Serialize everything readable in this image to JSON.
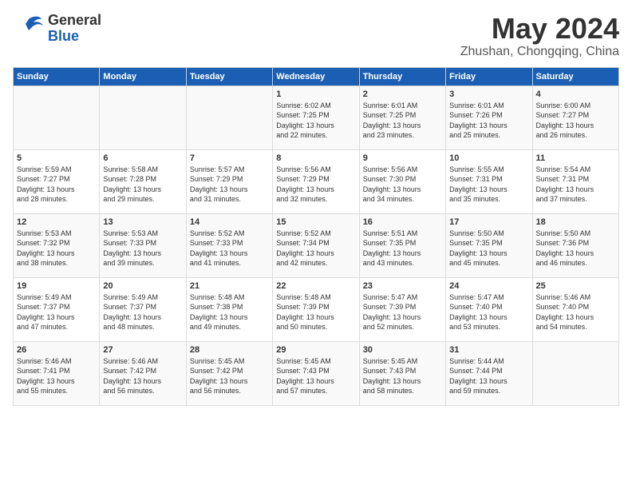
{
  "header": {
    "logo_general": "General",
    "logo_blue": "Blue",
    "month": "May 2024",
    "location": "Zhushan, Chongqing, China"
  },
  "weekdays": [
    "Sunday",
    "Monday",
    "Tuesday",
    "Wednesday",
    "Thursday",
    "Friday",
    "Saturday"
  ],
  "weeks": [
    [
      {
        "day": "",
        "content": ""
      },
      {
        "day": "",
        "content": ""
      },
      {
        "day": "",
        "content": ""
      },
      {
        "day": "1",
        "content": "Sunrise: 6:02 AM\nSunset: 7:25 PM\nDaylight: 13 hours\nand 22 minutes."
      },
      {
        "day": "2",
        "content": "Sunrise: 6:01 AM\nSunset: 7:25 PM\nDaylight: 13 hours\nand 23 minutes."
      },
      {
        "day": "3",
        "content": "Sunrise: 6:01 AM\nSunset: 7:26 PM\nDaylight: 13 hours\nand 25 minutes."
      },
      {
        "day": "4",
        "content": "Sunrise: 6:00 AM\nSunset: 7:27 PM\nDaylight: 13 hours\nand 26 minutes."
      }
    ],
    [
      {
        "day": "5",
        "content": "Sunrise: 5:59 AM\nSunset: 7:27 PM\nDaylight: 13 hours\nand 28 minutes."
      },
      {
        "day": "6",
        "content": "Sunrise: 5:58 AM\nSunset: 7:28 PM\nDaylight: 13 hours\nand 29 minutes."
      },
      {
        "day": "7",
        "content": "Sunrise: 5:57 AM\nSunset: 7:29 PM\nDaylight: 13 hours\nand 31 minutes."
      },
      {
        "day": "8",
        "content": "Sunrise: 5:56 AM\nSunset: 7:29 PM\nDaylight: 13 hours\nand 32 minutes."
      },
      {
        "day": "9",
        "content": "Sunrise: 5:56 AM\nSunset: 7:30 PM\nDaylight: 13 hours\nand 34 minutes."
      },
      {
        "day": "10",
        "content": "Sunrise: 5:55 AM\nSunset: 7:31 PM\nDaylight: 13 hours\nand 35 minutes."
      },
      {
        "day": "11",
        "content": "Sunrise: 5:54 AM\nSunset: 7:31 PM\nDaylight: 13 hours\nand 37 minutes."
      }
    ],
    [
      {
        "day": "12",
        "content": "Sunrise: 5:53 AM\nSunset: 7:32 PM\nDaylight: 13 hours\nand 38 minutes."
      },
      {
        "day": "13",
        "content": "Sunrise: 5:53 AM\nSunset: 7:33 PM\nDaylight: 13 hours\nand 39 minutes."
      },
      {
        "day": "14",
        "content": "Sunrise: 5:52 AM\nSunset: 7:33 PM\nDaylight: 13 hours\nand 41 minutes."
      },
      {
        "day": "15",
        "content": "Sunrise: 5:52 AM\nSunset: 7:34 PM\nDaylight: 13 hours\nand 42 minutes."
      },
      {
        "day": "16",
        "content": "Sunrise: 5:51 AM\nSunset: 7:35 PM\nDaylight: 13 hours\nand 43 minutes."
      },
      {
        "day": "17",
        "content": "Sunrise: 5:50 AM\nSunset: 7:35 PM\nDaylight: 13 hours\nand 45 minutes."
      },
      {
        "day": "18",
        "content": "Sunrise: 5:50 AM\nSunset: 7:36 PM\nDaylight: 13 hours\nand 46 minutes."
      }
    ],
    [
      {
        "day": "19",
        "content": "Sunrise: 5:49 AM\nSunset: 7:37 PM\nDaylight: 13 hours\nand 47 minutes."
      },
      {
        "day": "20",
        "content": "Sunrise: 5:49 AM\nSunset: 7:37 PM\nDaylight: 13 hours\nand 48 minutes."
      },
      {
        "day": "21",
        "content": "Sunrise: 5:48 AM\nSunset: 7:38 PM\nDaylight: 13 hours\nand 49 minutes."
      },
      {
        "day": "22",
        "content": "Sunrise: 5:48 AM\nSunset: 7:39 PM\nDaylight: 13 hours\nand 50 minutes."
      },
      {
        "day": "23",
        "content": "Sunrise: 5:47 AM\nSunset: 7:39 PM\nDaylight: 13 hours\nand 52 minutes."
      },
      {
        "day": "24",
        "content": "Sunrise: 5:47 AM\nSunset: 7:40 PM\nDaylight: 13 hours\nand 53 minutes."
      },
      {
        "day": "25",
        "content": "Sunrise: 5:46 AM\nSunset: 7:40 PM\nDaylight: 13 hours\nand 54 minutes."
      }
    ],
    [
      {
        "day": "26",
        "content": "Sunrise: 5:46 AM\nSunset: 7:41 PM\nDaylight: 13 hours\nand 55 minutes."
      },
      {
        "day": "27",
        "content": "Sunrise: 5:46 AM\nSunset: 7:42 PM\nDaylight: 13 hours\nand 56 minutes."
      },
      {
        "day": "28",
        "content": "Sunrise: 5:45 AM\nSunset: 7:42 PM\nDaylight: 13 hours\nand 56 minutes."
      },
      {
        "day": "29",
        "content": "Sunrise: 5:45 AM\nSunset: 7:43 PM\nDaylight: 13 hours\nand 57 minutes."
      },
      {
        "day": "30",
        "content": "Sunrise: 5:45 AM\nSunset: 7:43 PM\nDaylight: 13 hours\nand 58 minutes."
      },
      {
        "day": "31",
        "content": "Sunrise: 5:44 AM\nSunset: 7:44 PM\nDaylight: 13 hours\nand 59 minutes."
      },
      {
        "day": "",
        "content": ""
      }
    ]
  ]
}
